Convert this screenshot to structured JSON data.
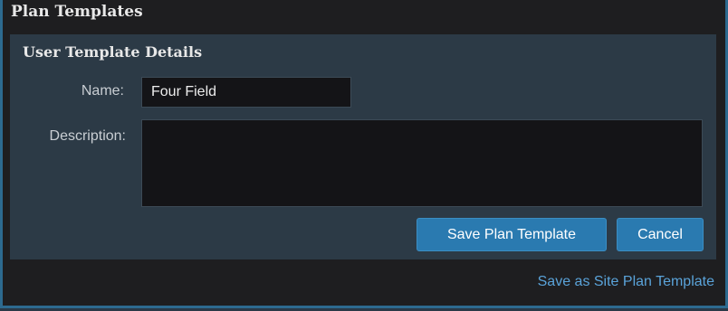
{
  "dialog": {
    "title": "Plan Templates"
  },
  "panel": {
    "heading": "User Template Details",
    "name_label": "Name:",
    "name_value": "Four Field",
    "description_label": "Description:",
    "description_value": ""
  },
  "actions": {
    "save_label": "Save Plan Template",
    "cancel_label": "Cancel"
  },
  "footer": {
    "site_link_label": "Save as Site Plan Template"
  },
  "colors": {
    "accent": "#2a7ab0",
    "link": "#5aa3d9",
    "panel_bg": "#2c3a46",
    "dialog_bg": "#1e1e20",
    "input_bg": "#141417"
  }
}
